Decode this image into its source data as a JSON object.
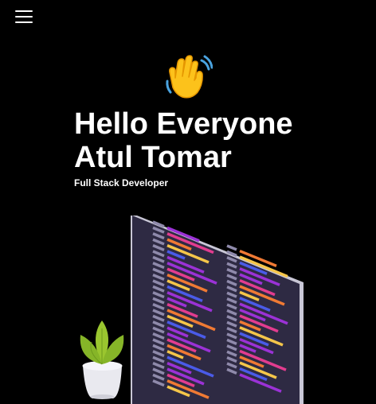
{
  "nav": {
    "menu_icon": "hamburger-menu-icon"
  },
  "hero": {
    "emoji_icon": "waving-hand-icon",
    "greeting": "Hello Everyone",
    "name": "Atul Tomar",
    "role": "Full Stack Developer"
  },
  "illustration": {
    "icon": "developer-monitor-illustration",
    "colors": {
      "monitor_body": "#2e2a43",
      "monitor_frame": "#c9c7d6",
      "code_purple": "#9b32d6",
      "code_pink": "#e23c8f",
      "code_orange": "#f07a34",
      "code_yellow": "#f5c64a",
      "code_blue": "#4a5be8",
      "plant_green": "#9ac62f",
      "pot": "#e9e9ef"
    }
  }
}
